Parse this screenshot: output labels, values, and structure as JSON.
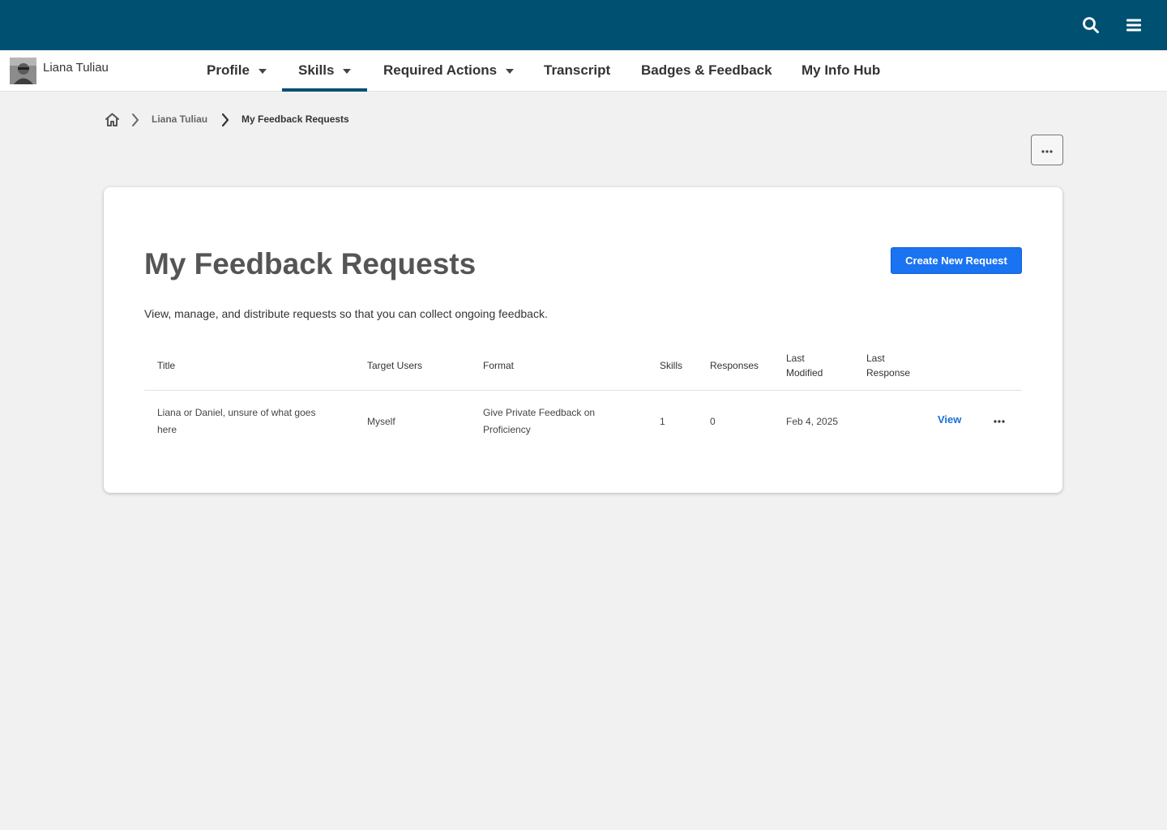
{
  "header": {
    "search_icon": "search-icon",
    "menu_icon": "hamburger-menu-icon",
    "bg_color": "#005072"
  },
  "user": {
    "name": "Liana Tuliau"
  },
  "nav": {
    "items": [
      {
        "label": "Profile",
        "dropdown": true
      },
      {
        "label": "Skills",
        "dropdown": true,
        "active": true
      },
      {
        "label": "Required Actions",
        "dropdown": true
      },
      {
        "label": "Transcript"
      },
      {
        "label": "Badges & Feedback"
      },
      {
        "label": "My Info Hub"
      }
    ]
  },
  "breadcrumb": {
    "home_icon": "home-icon",
    "items": [
      "Liana Tuliau",
      "My Feedback Requests"
    ]
  },
  "page": {
    "title": "My Feedback Requests",
    "description": "View, manage, and distribute requests so that you can collect ongoing feedback.",
    "create_button": "Create New Request",
    "accent_color": "#1a73f0"
  },
  "table": {
    "headers": {
      "title": "Title",
      "target_users": "Target Users",
      "format": "Format",
      "skills": "Skills",
      "responses": "Responses",
      "last_modified_1": "Last",
      "last_modified_2": "Modified",
      "last_response_1": "Last",
      "last_response_2": "Response"
    },
    "rows": [
      {
        "title_1": "Liana or Daniel, unsure of what goes",
        "title_2": "here",
        "target_users": "Myself",
        "format_1": "Give Private Feedback on",
        "format_2": "Proficiency",
        "skills": "1",
        "responses": "0",
        "last_modified": "Feb 4, 2025",
        "last_response": "",
        "action": "View"
      }
    ]
  }
}
